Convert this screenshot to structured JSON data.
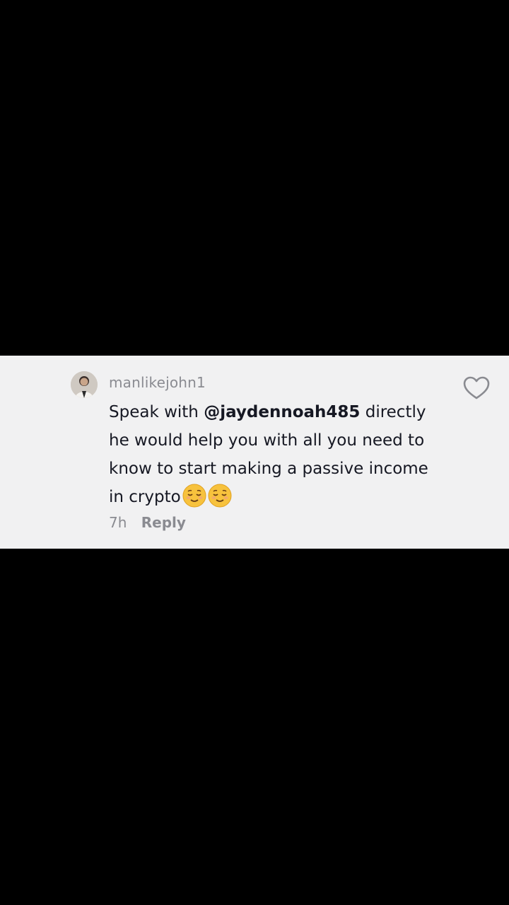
{
  "comment": {
    "username": "manlikejohn1",
    "text_before": "Speak with ",
    "mention": "@jaydennoah485",
    "text_after": " directly he would help you with all you need to know to start making a passive income in crypto",
    "emojis": [
      "relieved-face-emoji",
      "relieved-face-emoji"
    ],
    "time": "7h",
    "reply_label": "Reply",
    "like_icon": "heart-outline-icon"
  },
  "colors": {
    "background": "#000000",
    "card": "#f1f1f2",
    "text_primary": "#161823",
    "text_secondary": "#8a8b91",
    "emoji_yellow": "#f7c23d"
  }
}
